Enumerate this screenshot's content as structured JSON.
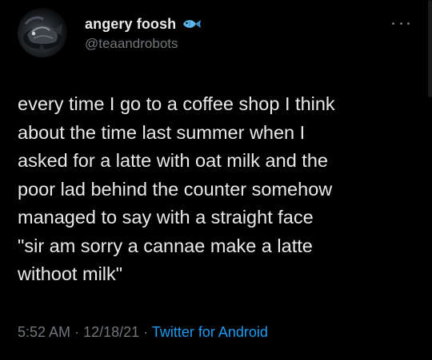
{
  "user": {
    "display_name": "angery foosh",
    "handle": "@teaandrobots",
    "badge_icon": "fish-icon",
    "avatar_icon": "avatar-fish-photo"
  },
  "tweet": {
    "text": "every time I go to a coffee shop I think\nabout the time last summer when I\nasked for a latte with oat milk and the\npoor lad behind the counter somehow\nmanaged to say with a straight face\n\"sir am sorry a cannae make a latte\nwithoot milk\"",
    "time": "5:52 AM",
    "date": "12/18/21",
    "separator": "·",
    "source": "Twitter for Android"
  },
  "menu": {
    "icon": "more-icon"
  },
  "colors": {
    "background": "#000000",
    "text": "#e7e9ea",
    "muted": "#71767b",
    "link": "#1d9bf0"
  }
}
